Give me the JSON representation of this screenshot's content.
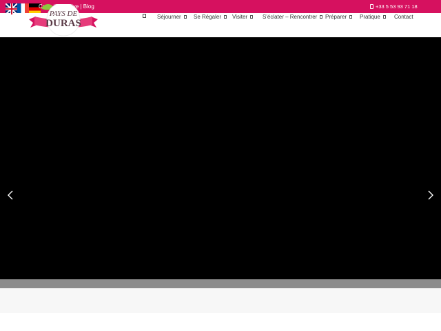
{
  "topbar": {
    "links": [
      "Carte interactive",
      "Blog"
    ],
    "separator": " | ",
    "phone": "+33 5 53 93 71 18",
    "color": "#d6115f"
  },
  "flags": [
    {
      "lang": "en",
      "icon": "uk-flag-icon"
    },
    {
      "lang": "fr",
      "icon": "french-flag-icon"
    },
    {
      "lang": "de",
      "icon": "german-flag-icon"
    }
  ],
  "logo": {
    "line1": "PAYS DE",
    "line2": "DURAS"
  },
  "nav": {
    "items": [
      {
        "label": "Séjourner"
      },
      {
        "label": "Se Régaler"
      },
      {
        "label": "Visiter"
      },
      {
        "label": "S'éclater – Rencontrer"
      },
      {
        "label": "Préparer"
      },
      {
        "label": "Pratique"
      },
      {
        "label": "Contact"
      }
    ]
  }
}
